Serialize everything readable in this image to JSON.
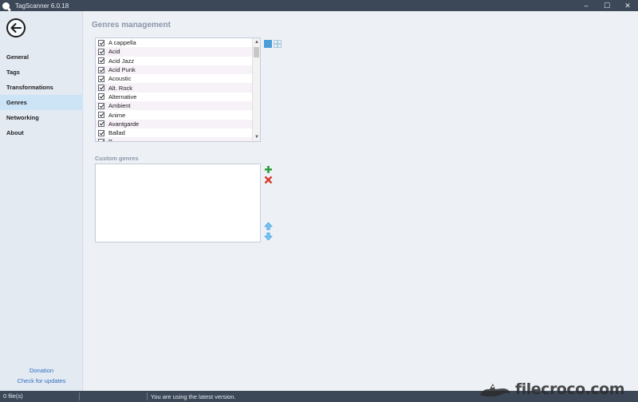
{
  "window": {
    "title": "TagScanner 6.0.18",
    "controls": [
      "–",
      "☐",
      "✕"
    ]
  },
  "sidebar": {
    "back_icon": "arrow-left-icon",
    "items": [
      {
        "label": "General",
        "active": false
      },
      {
        "label": "Tags",
        "active": false
      },
      {
        "label": "Transformations",
        "active": false
      },
      {
        "label": "Genres",
        "active": true
      },
      {
        "label": "Networking",
        "active": false
      },
      {
        "label": "About",
        "active": false
      }
    ],
    "links": [
      "Donation",
      "Check for updates"
    ]
  },
  "main": {
    "title": "Genres management",
    "genres": [
      "A cappella",
      "Acid",
      "Acid Jazz",
      "Acid Punk",
      "Acoustic",
      "Alt. Rock",
      "Alternative",
      "Ambient",
      "Anime",
      "Avantgarde",
      "Ballad",
      "B..."
    ],
    "tools": [
      "check-all-icon",
      "uncheck-all-icon"
    ],
    "custom_label": "Custom genres",
    "custom_tools": [
      "add-icon",
      "delete-icon",
      "move-up-icon",
      "move-down-icon"
    ]
  },
  "status": {
    "files": "0 file(s)",
    "message": "You are using the latest version."
  },
  "watermark": {
    "text": "filecroco.com"
  },
  "colors": {
    "titlebar": "#3c4858",
    "accent_active": "#cde4f7",
    "link": "#2e6fc1",
    "add_green": "#2a9d3a",
    "delete_red": "#d93a2b",
    "arrow_blue": "#3ba4e4"
  }
}
